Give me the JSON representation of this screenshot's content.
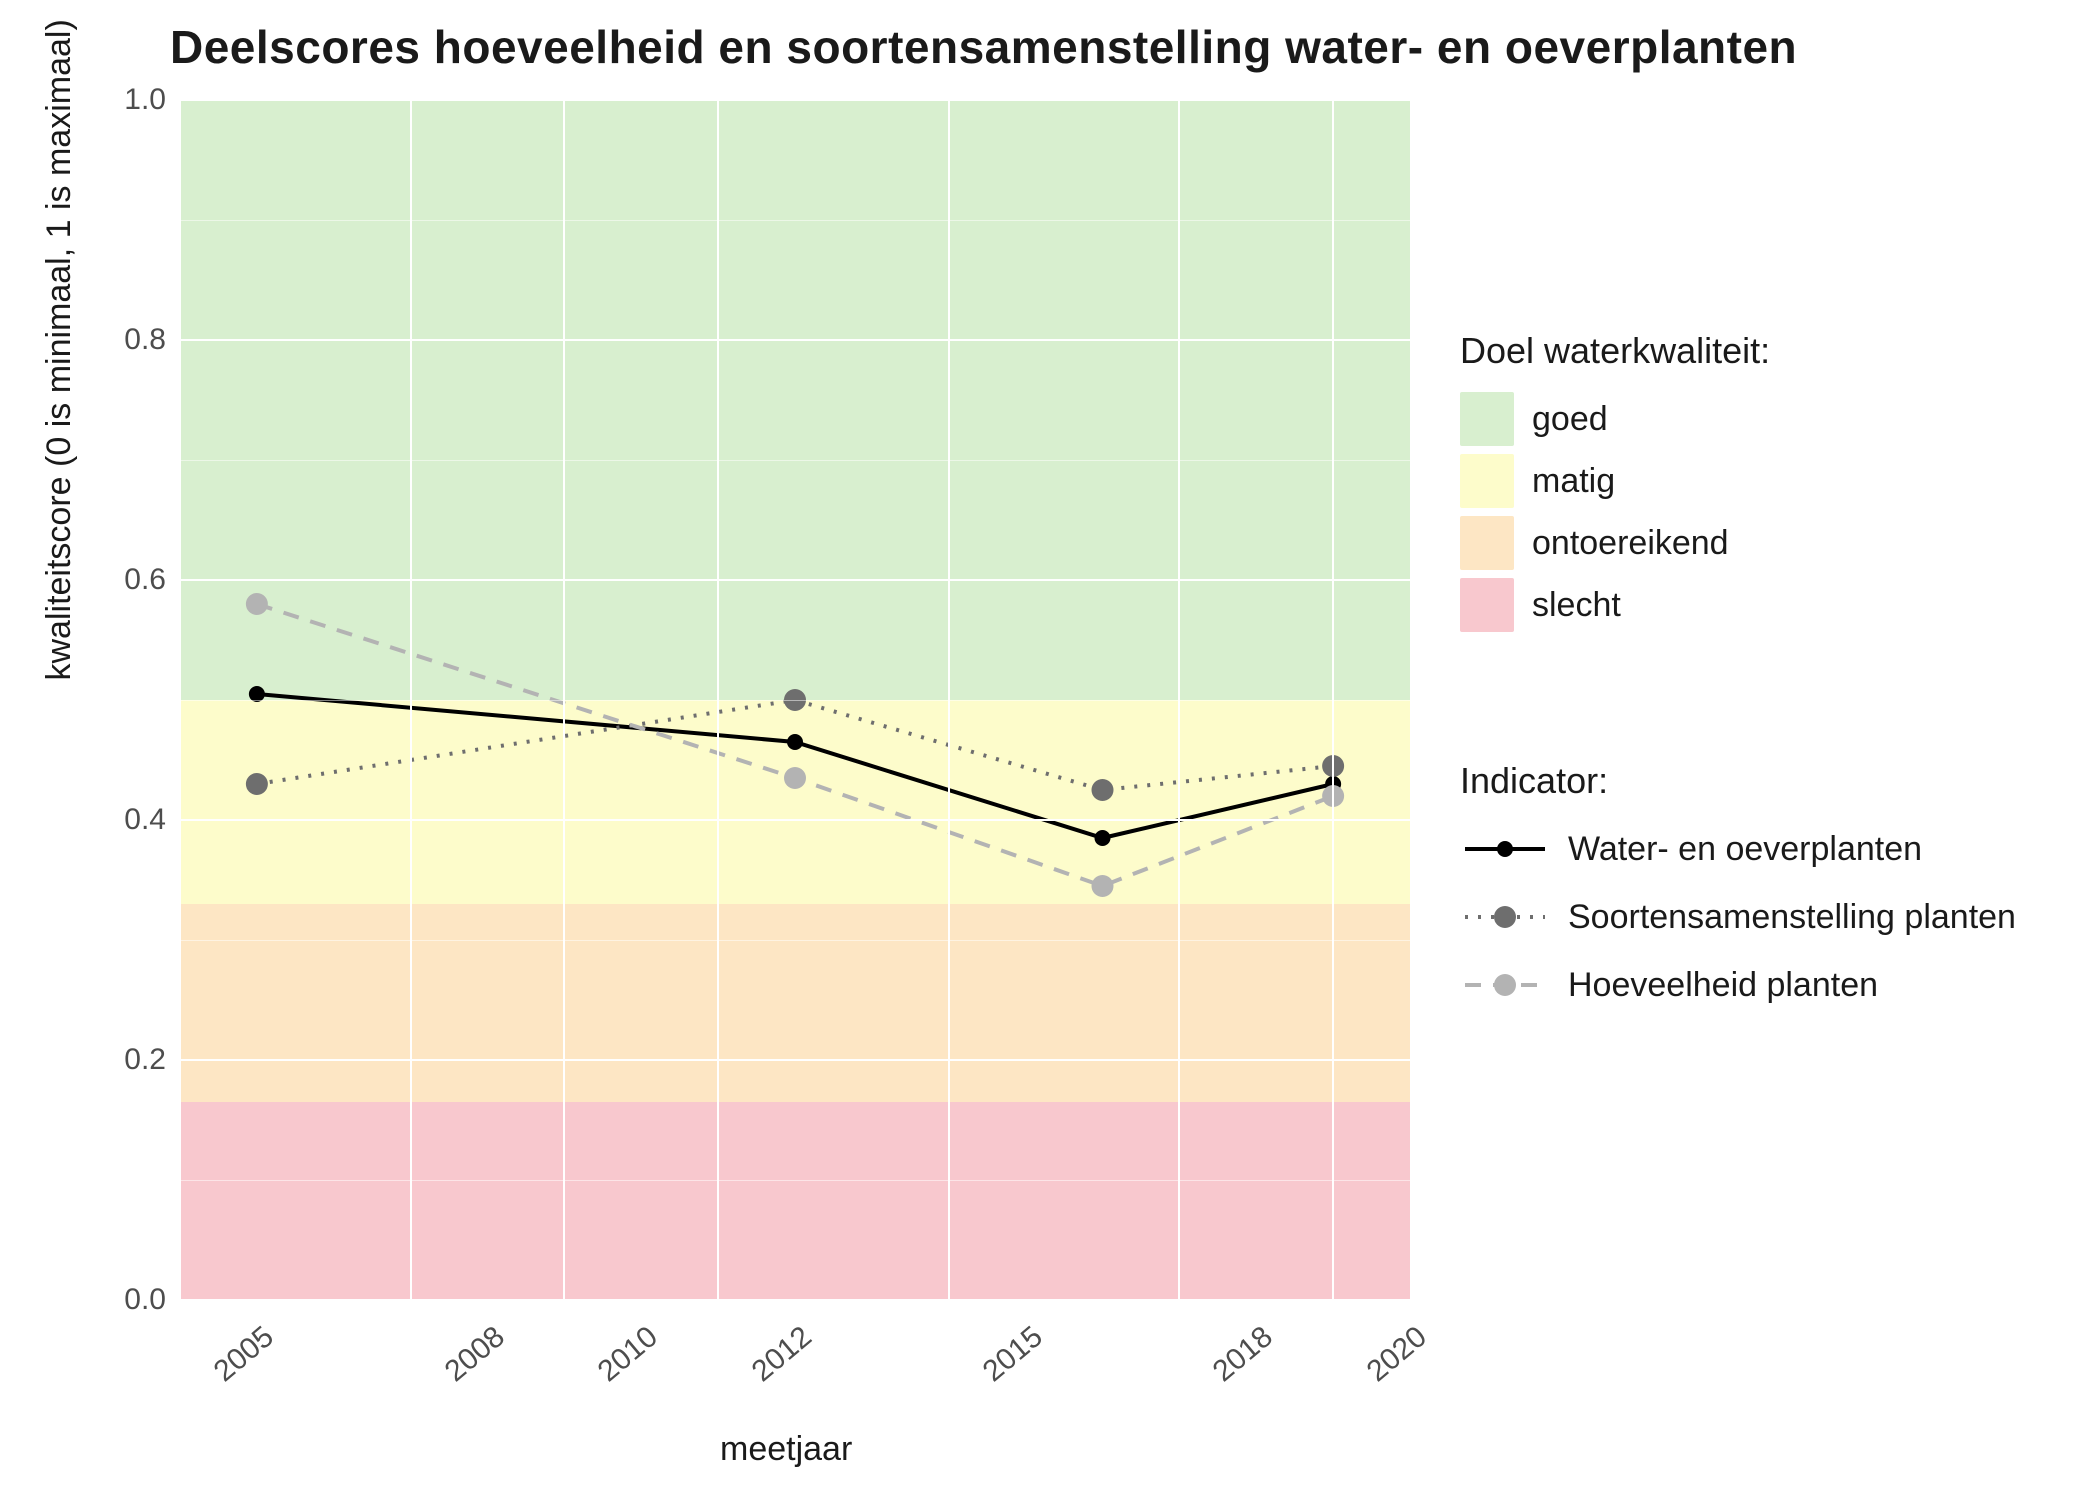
{
  "title": "Deelscores hoeveelheid en soortensamenstelling water- en oeverplanten",
  "xlabel": "meetjaar",
  "ylabel": "kwaliteitscore (0 is minimaal, 1 is maximaal)",
  "legend_bands_title": "Doel waterkwaliteit:",
  "legend_series_title": "Indicator:",
  "y_ticks": [
    "0.0",
    "0.2",
    "0.4",
    "0.6",
    "0.8",
    "1.0"
  ],
  "x_ticks": [
    "2005",
    "2008",
    "2010",
    "2012",
    "2015",
    "2018",
    "2020"
  ],
  "bands": [
    {
      "name": "goed",
      "from": 0.5,
      "to": 1.0,
      "color": "#d8efcf"
    },
    {
      "name": "matig",
      "from": 0.33,
      "to": 0.5,
      "color": "#fdfccb"
    },
    {
      "name": "ontoereikend",
      "from": 0.165,
      "to": 0.33,
      "color": "#fde6c4"
    },
    {
      "name": "slecht",
      "from": 0.0,
      "to": 0.165,
      "color": "#f8c8ce"
    }
  ],
  "series": [
    {
      "name": "Water- en oeverplanten",
      "color": "#000000",
      "dash": "solid",
      "x": [
        2006,
        2013,
        2017,
        2020
      ],
      "y": [
        0.505,
        0.465,
        0.385,
        0.43
      ],
      "point_size": 16
    },
    {
      "name": "Soortensamenstelling planten",
      "color": "#6e6e6e",
      "dash": "dotted",
      "x": [
        2006,
        2013,
        2017,
        2020
      ],
      "y": [
        0.43,
        0.5,
        0.425,
        0.445
      ],
      "point_size": 22
    },
    {
      "name": "Hoeveelheid planten",
      "color": "#b3b3b3",
      "dash": "dashed",
      "x": [
        2006,
        2013,
        2017,
        2020
      ],
      "y": [
        0.58,
        0.435,
        0.345,
        0.42
      ],
      "point_size": 22
    }
  ],
  "chart_data": {
    "type": "line",
    "title": "Deelscores hoeveelheid en soortensamenstelling water- en oeverplanten",
    "xlabel": "meetjaar",
    "ylabel": "kwaliteitscore (0 is minimaal, 1 is maximaal)",
    "x": [
      2006,
      2013,
      2017,
      2020
    ],
    "series": [
      {
        "name": "Water- en oeverplanten",
        "values": [
          0.505,
          0.465,
          0.385,
          0.43
        ]
      },
      {
        "name": "Soortensamenstelling planten",
        "values": [
          0.43,
          0.5,
          0.425,
          0.445
        ]
      },
      {
        "name": "Hoeveelheid planten",
        "values": [
          0.58,
          0.435,
          0.345,
          0.42
        ]
      }
    ],
    "ylim": [
      0.0,
      1.0
    ],
    "xlim": [
      2005,
      2021
    ],
    "x_ticks": [
      2005,
      2008,
      2010,
      2012,
      2015,
      2018,
      2020
    ],
    "y_ticks": [
      0.0,
      0.2,
      0.4,
      0.6,
      0.8,
      1.0
    ],
    "bands": [
      {
        "name": "goed",
        "range": [
          0.5,
          1.0
        ]
      },
      {
        "name": "matig",
        "range": [
          0.33,
          0.5
        ]
      },
      {
        "name": "ontoereikend",
        "range": [
          0.165,
          0.33
        ]
      },
      {
        "name": "slecht",
        "range": [
          0.0,
          0.165
        ]
      }
    ],
    "legend_position": "right"
  }
}
